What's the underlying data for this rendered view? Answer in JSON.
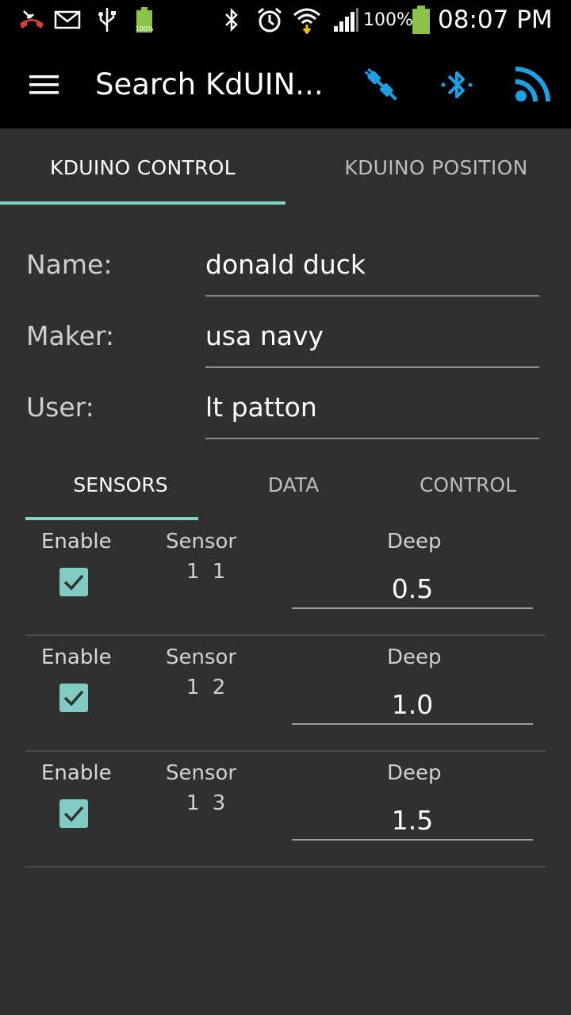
{
  "statusbar": {
    "battery_small_label": "100%",
    "battery_percent": "100%",
    "time": "08:07 PM",
    "icons": [
      "missed-call-icon",
      "email-icon",
      "usb-icon",
      "battery-charging-icon",
      "bluetooth-icon",
      "alarm-icon",
      "wifi-icon",
      "signal-icon",
      "battery-icon"
    ]
  },
  "toolbar": {
    "title": "Search KdUIN...",
    "actions": [
      "plug-connect-icon",
      "bluetooth-icon",
      "broadcast-icon"
    ],
    "accent": "#1da1e6"
  },
  "main_tabs": [
    {
      "label": "KDUINO CONTROL",
      "active": true
    },
    {
      "label": "KDUINO POSITION",
      "active": false
    }
  ],
  "form": {
    "name_label": "Name:",
    "name_value": "donald duck",
    "maker_label": "Maker:",
    "maker_value": "usa navy",
    "user_label": "User:",
    "user_value": "lt patton"
  },
  "sub_tabs": [
    {
      "label": "SENSORS",
      "active": true
    },
    {
      "label": "DATA",
      "active": false
    },
    {
      "label": "CONTROL",
      "active": false
    }
  ],
  "sensors": [
    {
      "enable_label": "Enable",
      "checked": true,
      "sensor_label": "Sensor",
      "sensor_num": "1 1",
      "deep_label": "Deep",
      "deep_value": "0.5"
    },
    {
      "enable_label": "Enable",
      "checked": true,
      "sensor_label": "Sensor",
      "sensor_num": "1 2",
      "deep_label": "Deep",
      "deep_value": "1.0"
    },
    {
      "enable_label": "Enable",
      "checked": true,
      "sensor_label": "Sensor",
      "sensor_num": "1 3",
      "deep_label": "Deep",
      "deep_value": "1.5"
    }
  ],
  "colors": {
    "tab_indicator": "#7fd4c8",
    "checkbox": "#80cbc4",
    "background": "#303030"
  }
}
